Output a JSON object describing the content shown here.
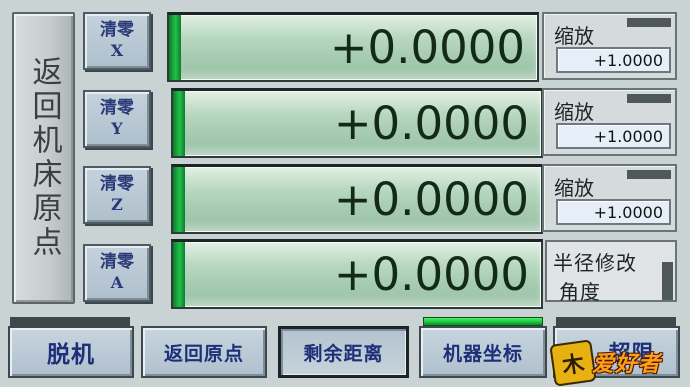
{
  "home_button": {
    "label": "返回机床原点"
  },
  "axes": [
    {
      "zero_label": "清零",
      "axis": "X",
      "value": "+0.0000",
      "scale_label": "缩放",
      "scale_value": "+1.0000"
    },
    {
      "zero_label": "清零",
      "axis": "Y",
      "value": "+0.0000",
      "scale_label": "缩放",
      "scale_value": "+1.0000"
    },
    {
      "zero_label": "清零",
      "axis": "Z",
      "value": "+0.0000",
      "scale_label": "缩放",
      "scale_value": "+1.0000"
    },
    {
      "zero_label": "清零",
      "axis": "A",
      "value": "+0.0000"
    }
  ],
  "radius_panel": {
    "line1": "半径修改",
    "line2": "角度"
  },
  "bottom_buttons": [
    {
      "label": "脱机"
    },
    {
      "label": "返回原点"
    },
    {
      "label": "剩余距离",
      "pressed": true
    },
    {
      "label": "机器坐标",
      "active": true
    },
    {
      "label": "超限"
    }
  ],
  "watermark": {
    "mark": "木",
    "text": "爱好者"
  },
  "colors": {
    "background": "#c9d3d4",
    "dro_green": "#a3c9ae",
    "indicator_green": "#1fc24a",
    "button_text": "#1d2f78"
  }
}
